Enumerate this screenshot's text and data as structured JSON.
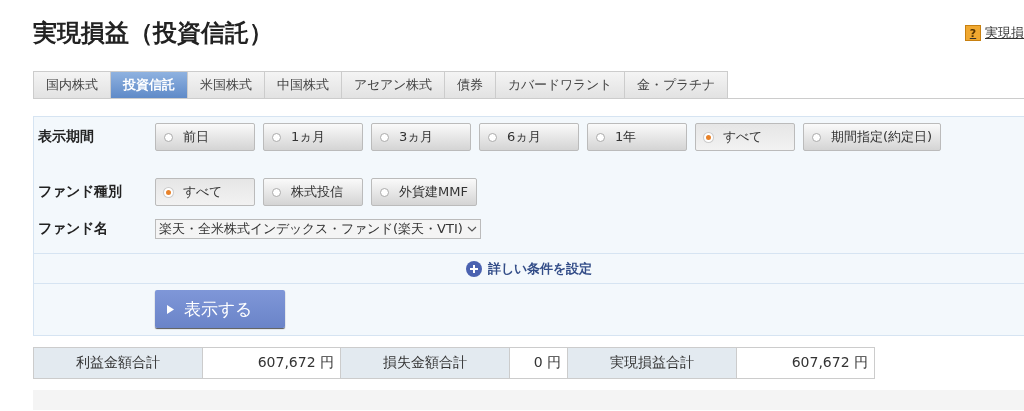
{
  "title": "実現損益（投資信託）",
  "help_link": {
    "icon": "?",
    "label": "実現損"
  },
  "tabs": [
    {
      "label": "国内株式",
      "selected": false
    },
    {
      "label": "投資信託",
      "selected": true
    },
    {
      "label": "米国株式",
      "selected": false
    },
    {
      "label": "中国株式",
      "selected": false
    },
    {
      "label": "アセアン株式",
      "selected": false
    },
    {
      "label": "債券",
      "selected": false
    },
    {
      "label": "カバードワラント",
      "selected": false
    },
    {
      "label": "金・プラチナ",
      "selected": false
    }
  ],
  "filters": {
    "period": {
      "label": "表示期間",
      "options": [
        {
          "label": "前日",
          "selected": false
        },
        {
          "label": "1ヵ月",
          "selected": false
        },
        {
          "label": "3ヵ月",
          "selected": false
        },
        {
          "label": "6ヵ月",
          "selected": false
        },
        {
          "label": "1年",
          "selected": false
        },
        {
          "label": "すべて",
          "selected": true
        },
        {
          "label": "期間指定(約定日)",
          "selected": false
        }
      ]
    },
    "fund_type": {
      "label": "ファンド種別",
      "options": [
        {
          "label": "すべて",
          "selected": true
        },
        {
          "label": "株式投信",
          "selected": false
        },
        {
          "label": "外貨建MMF",
          "selected": false
        }
      ]
    },
    "fund_name": {
      "label": "ファンド名",
      "value": "楽天・全米株式インデックス・ファンド(楽天・VTI)"
    },
    "details_link": "詳しい条件を設定",
    "submit": "表示する"
  },
  "summary": [
    {
      "label": "利益金額合計",
      "value": "607,672 円"
    },
    {
      "label": "損失金額合計",
      "value": "0 円"
    },
    {
      "label": "実現損益合計",
      "value": "607,672 円"
    }
  ]
}
